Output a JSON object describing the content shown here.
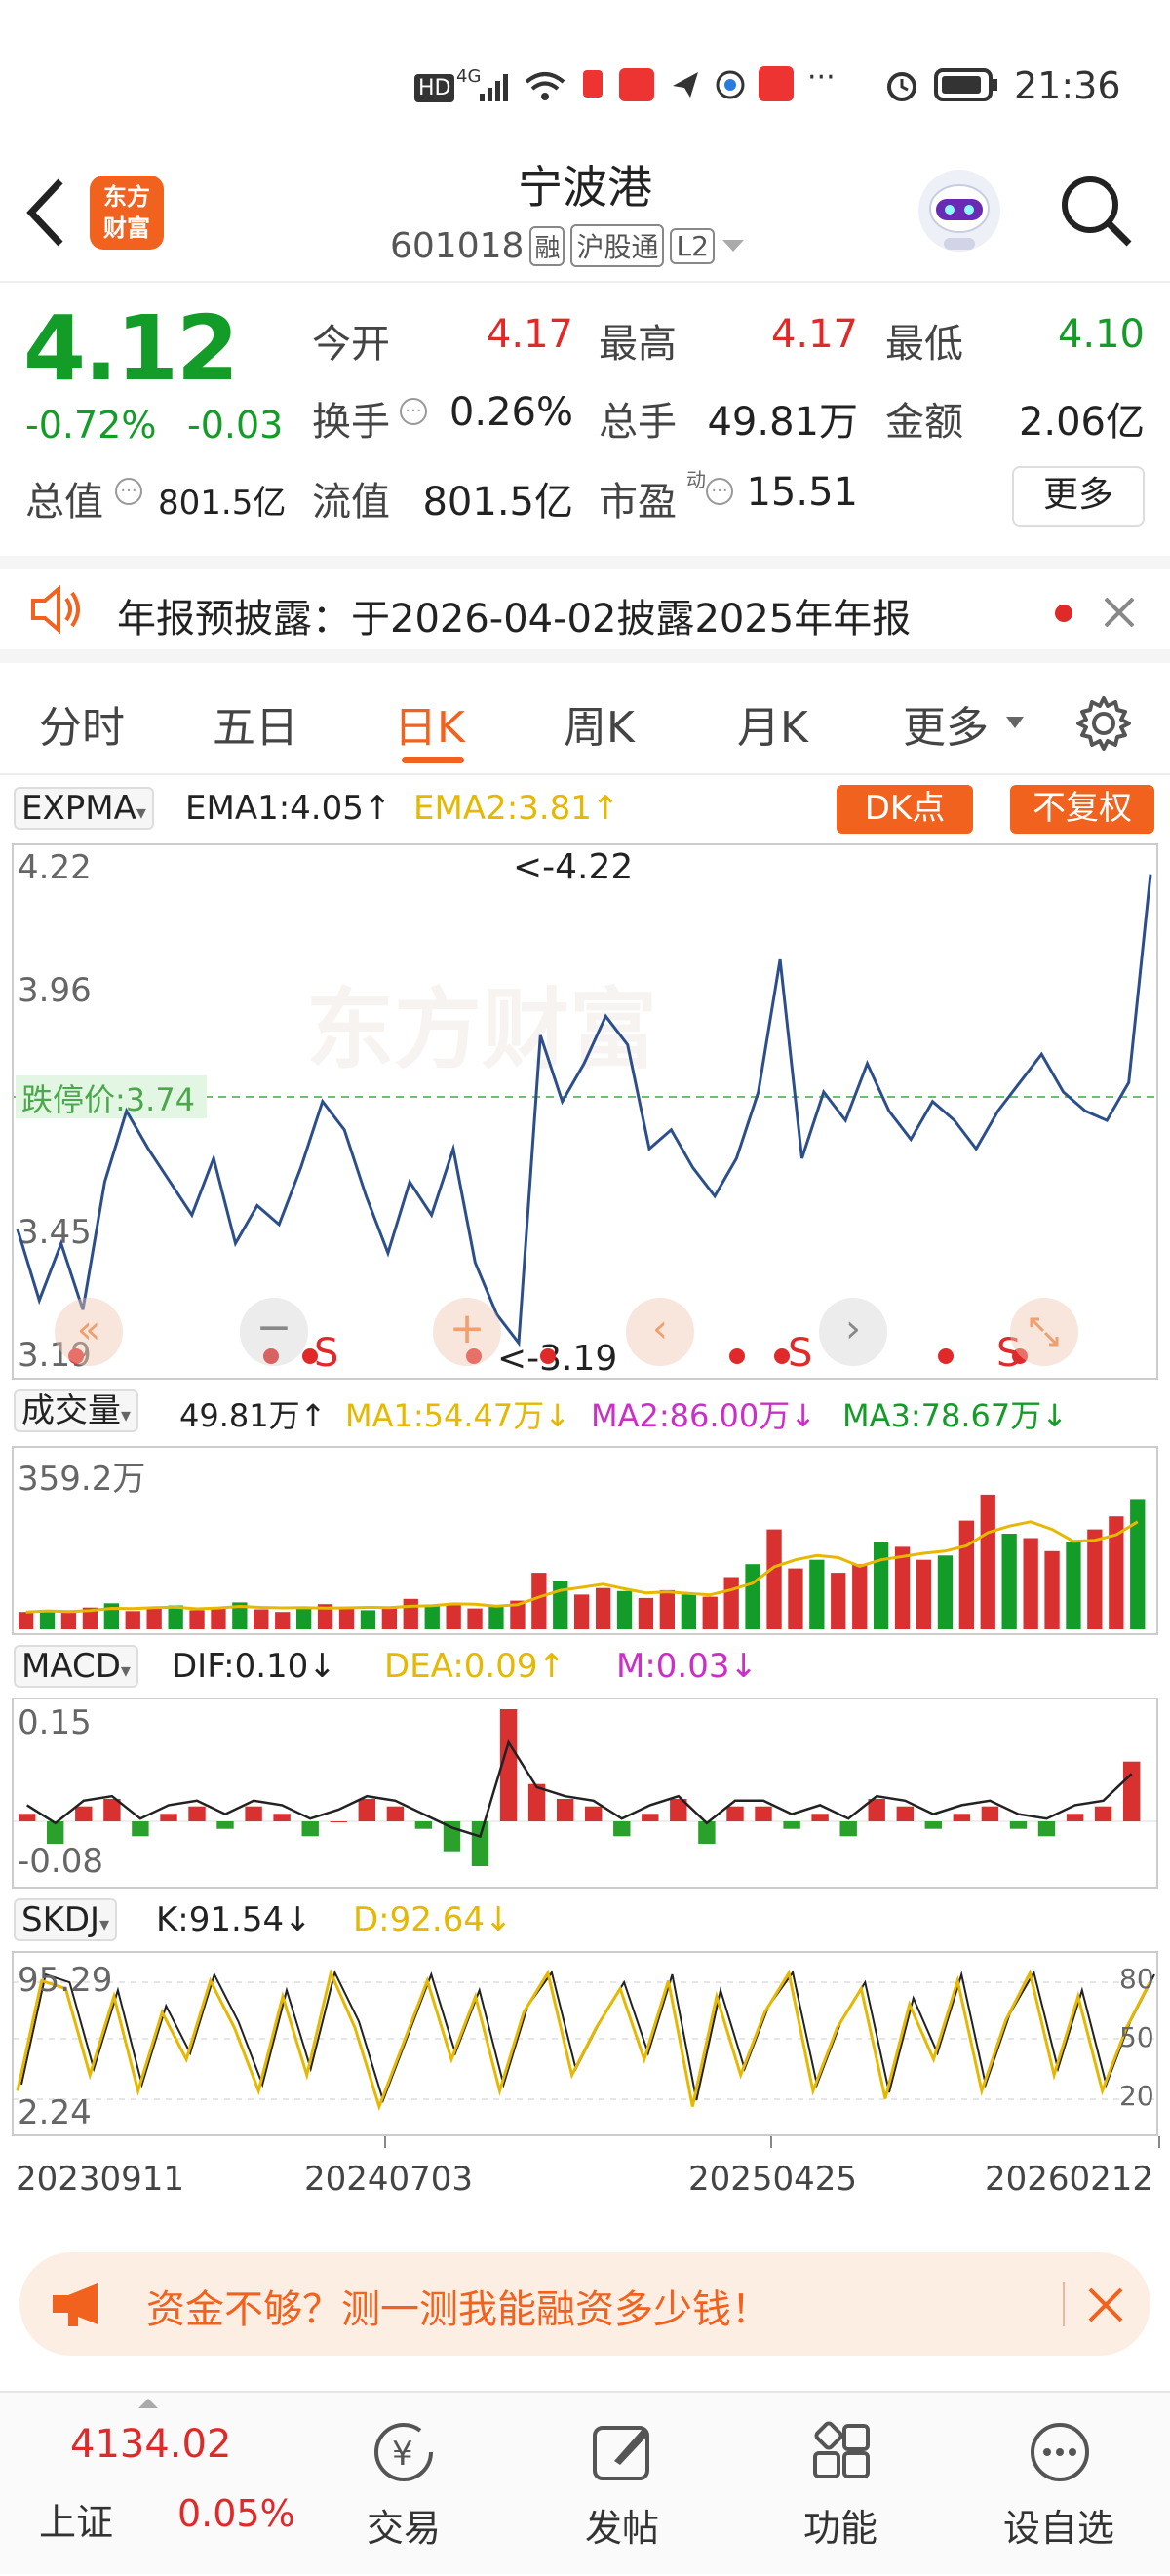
{
  "status_bar": {
    "time": "21:36",
    "hd": "HD",
    "signal_gen": "4G",
    "wifi_gen": "6"
  },
  "header": {
    "app_logo_line1": "东方",
    "app_logo_line2": "财富",
    "stock_name": "宁波港",
    "stock_code": "601018",
    "badge_rong": "融",
    "badge_hgt": "沪股通",
    "badge_level": "L2"
  },
  "quote": {
    "price": "4.12",
    "change_pct": "-0.72%",
    "change_amt": "-0.03",
    "open_label": "今开",
    "open_value": "4.17",
    "high_label": "最高",
    "high_value": "4.17",
    "low_label": "最低",
    "low_value": "4.10",
    "turnover_label": "换手",
    "turnover_value": "0.26%",
    "volume_label": "总手",
    "volume_value": "49.81万",
    "amount_label": "金额",
    "amount_value": "2.06亿",
    "mktcap_label": "总值",
    "mktcap_value": "801.5亿",
    "float_label": "流值",
    "float_value": "801.5亿",
    "pe_label": "市盈",
    "pe_sup": "动",
    "pe_value": "15.51",
    "more_button": "更多"
  },
  "notice": {
    "text": "年报预披露：于2026-04-02披露2025年年报"
  },
  "tabs": [
    {
      "label": "分时",
      "active": false
    },
    {
      "label": "五日",
      "active": false
    },
    {
      "label": "日K",
      "active": true
    },
    {
      "label": "周K",
      "active": false
    },
    {
      "label": "月K",
      "active": false
    },
    {
      "label": "更多",
      "active": false
    }
  ],
  "expma": {
    "selector": "EXPMA",
    "ema1": "EMA1:4.05↑",
    "ema2": "EMA2:3.81↑",
    "dk_button": "DK点",
    "fq_button": "不复权",
    "limit_label": "跌停价:3.74",
    "max_marker": "<-4.22",
    "min_marker": "<-3.19",
    "sell_marker": "S"
  },
  "volume": {
    "selector": "成交量",
    "vol": "49.81万↑",
    "ma1": "MA1:54.47万↓",
    "ma2": "MA2:86.00万↓",
    "ma3": "MA3:78.67万↓"
  },
  "macd": {
    "selector": "MACD",
    "dif": "DIF:0.10↓",
    "dea": "DEA:0.09↑",
    "m": "M:0.03↓"
  },
  "skdj": {
    "selector": "SKDJ",
    "k": "K:91.54↓",
    "d": "D:92.64↓"
  },
  "chart_data": [
    {
      "type": "line",
      "title": "EXPMA",
      "y_axis_labels": [
        "4.22",
        "3.96",
        "3.74",
        "3.45",
        "3.19"
      ],
      "ylim": [
        3.19,
        4.22
      ],
      "limit_down_price": 3.74,
      "series": [
        {
          "name": "price",
          "values": [
            3.45,
            3.3,
            3.42,
            3.28,
            3.55,
            3.7,
            3.62,
            3.55,
            3.48,
            3.6,
            3.42,
            3.5,
            3.46,
            3.58,
            3.72,
            3.66,
            3.52,
            3.4,
            3.55,
            3.48,
            3.62,
            3.38,
            3.27,
            3.21,
            3.86,
            3.72,
            3.8,
            3.9,
            3.84,
            3.62,
            3.66,
            3.58,
            3.52,
            3.6,
            3.74,
            4.02,
            3.6,
            3.74,
            3.68,
            3.8,
            3.7,
            3.64,
            3.72,
            3.68,
            3.62,
            3.7,
            3.76,
            3.82,
            3.74,
            3.7,
            3.68,
            3.76,
            4.2
          ]
        }
      ]
    },
    {
      "type": "bar",
      "title": "成交量",
      "y_axis_labels": [
        "359.2万"
      ],
      "ylim": [
        0,
        359.2
      ],
      "series": [
        {
          "name": "volume",
          "values": [
            40,
            45,
            38,
            50,
            60,
            42,
            48,
            55,
            44,
            50,
            62,
            46,
            40,
            52,
            58,
            48,
            44,
            50,
            70,
            54,
            60,
            48,
            52,
            66,
            130,
            110,
            80,
            95,
            88,
            72,
            90,
            80,
            75,
            120,
            150,
            230,
            140,
            160,
            130,
            150,
            200,
            190,
            160,
            170,
            250,
            310,
            220,
            210,
            180,
            200,
            230,
            260,
            300
          ]
        }
      ]
    },
    {
      "type": "bar",
      "title": "MACD",
      "y_axis_labels": [
        "0.15",
        "-0.08"
      ],
      "ylim": [
        -0.08,
        0.15
      ],
      "series": [
        {
          "name": "M",
          "values": [
            0.01,
            -0.03,
            0.02,
            0.03,
            -0.02,
            0.01,
            0.02,
            -0.01,
            0.02,
            0.01,
            -0.02,
            0.0,
            0.03,
            0.02,
            -0.01,
            -0.04,
            -0.06,
            0.15,
            0.05,
            0.03,
            0.02,
            -0.02,
            0.01,
            0.03,
            -0.03,
            0.02,
            0.02,
            -0.01,
            0.01,
            -0.02,
            0.03,
            0.02,
            -0.01,
            0.01,
            0.02,
            -0.01,
            -0.02,
            0.01,
            0.02,
            0.08
          ]
        }
      ]
    },
    {
      "type": "line",
      "title": "SKDJ",
      "y_axis_labels": [
        "95.29",
        "2.24"
      ],
      "right_axis_labels": [
        "80",
        "50",
        "20"
      ],
      "ylim": [
        2.24,
        95.29
      ],
      "x_tick_labels": [
        "20230911",
        "20240703",
        "20250425",
        "20260212"
      ],
      "series": [
        {
          "name": "K",
          "values": [
            20,
            90,
            85,
            30,
            80,
            20,
            70,
            40,
            90,
            60,
            20,
            80,
            30,
            95,
            60,
            10,
            50,
            90,
            40,
            80,
            20,
            70,
            95,
            30,
            60,
            85,
            40,
            90,
            10,
            80,
            30,
            70,
            95,
            20,
            60,
            85,
            15,
            75,
            40,
            90,
            20,
            65,
            95,
            30,
            80,
            20,
            60,
            90
          ]
        }
      ]
    }
  ],
  "banner": {
    "text": "资金不够？测一测我能融资多少钱！"
  },
  "bottom_nav": {
    "index_value": "4134.02",
    "index_name": "上证",
    "index_change": "0.05%",
    "items": [
      {
        "label": "交易"
      },
      {
        "label": "发帖"
      },
      {
        "label": "功能"
      },
      {
        "label": "设自选"
      }
    ]
  }
}
